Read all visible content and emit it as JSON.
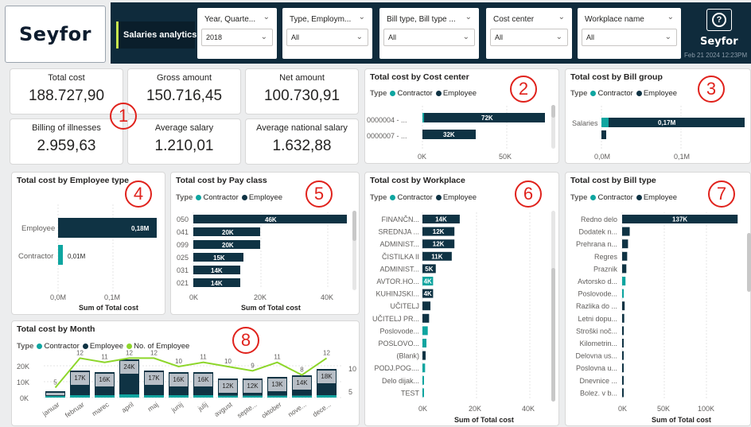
{
  "app": {
    "logo": "Seyfor",
    "report_title": "Salaries analytics",
    "header_logo": "Seyfor",
    "header_date": "Feb 21 2024 12:23PM"
  },
  "filters": [
    {
      "label": "Year, Quarte...",
      "value": "2018"
    },
    {
      "label": "Type, Employm...",
      "value": "All"
    },
    {
      "label": "Bill type, Bill type ...",
      "value": "All"
    },
    {
      "label": "Cost center",
      "value": "All"
    },
    {
      "label": "Workplace name",
      "value": "All"
    }
  ],
  "kpis": [
    {
      "label": "Total cost",
      "value": "188.727,90"
    },
    {
      "label": "Gross amount",
      "value": "150.716,45"
    },
    {
      "label": "Net amount",
      "value": "100.730,91"
    },
    {
      "label": "Billing of illnesses",
      "value": "2.959,63"
    },
    {
      "label": "Average salary",
      "value": "1.210,01"
    },
    {
      "label": "Average national salary",
      "value": "1.632,88"
    }
  ],
  "colors": {
    "contractor": "#0ea5a0",
    "employee": "#0f3344",
    "employees_line": "#8dd62a",
    "header": "#0f2b3c",
    "marker": "#e0221c",
    "gray_bar": "#b7bec6"
  },
  "legend": {
    "type": "Type",
    "contractor": "Contractor",
    "employee": "Employee",
    "no_employee": "No. of Employee"
  },
  "markers": [
    "1",
    "2",
    "3",
    "4",
    "5",
    "6",
    "7",
    "8"
  ],
  "cost_center": {
    "title": "Total cost by Cost center",
    "rows": [
      {
        "label": "0000004 - ...",
        "value": "72K"
      },
      {
        "label": "0000007 - ...",
        "value": "32K"
      }
    ],
    "ticks": [
      "0K",
      "50K"
    ]
  },
  "bill_group": {
    "title": "Total cost by Bill group",
    "rows": [
      {
        "label": "Salaries",
        "value": "0,17M"
      }
    ],
    "ticks": [
      "0,0M",
      "0,1M"
    ]
  },
  "employee_type": {
    "title": "Total cost by Employee type",
    "rows": [
      {
        "label": "Employee",
        "value": "0,18M"
      },
      {
        "label": "Contractor",
        "value": "0,01M"
      }
    ],
    "ticks": [
      "0,0M",
      "0,1M"
    ],
    "xlabel": "Sum of Total cost"
  },
  "pay_class": {
    "title": "Total cost by Pay class",
    "rows": [
      {
        "label": "050",
        "value": "46K"
      },
      {
        "label": "041",
        "value": "20K"
      },
      {
        "label": "099",
        "value": "20K"
      },
      {
        "label": "025",
        "value": "15K"
      },
      {
        "label": "031",
        "value": "14K"
      },
      {
        "label": "021",
        "value": "14K"
      }
    ],
    "ticks": [
      "0K",
      "20K",
      "40K"
    ],
    "xlabel": "Sum of Total cost"
  },
  "workplace": {
    "title": "Total cost by Workplace",
    "rows": [
      {
        "label": "FINANČN...",
        "value": "14K"
      },
      {
        "label": "SREDNJA ...",
        "value": "12K"
      },
      {
        "label": "ADMINIST...",
        "value": "12K"
      },
      {
        "label": "ČISTILKA II",
        "value": "11K"
      },
      {
        "label": "ADMINIST...",
        "value": "5K"
      },
      {
        "label": "AVTOR.HO...",
        "value": "4K"
      },
      {
        "label": "KUHINJSKI...",
        "value": "4K"
      },
      {
        "label": "UČITELJ",
        "value": ""
      },
      {
        "label": "UČITELJ PR...",
        "value": ""
      },
      {
        "label": "Poslovode...",
        "value": ""
      },
      {
        "label": "POSLOVO...",
        "value": ""
      },
      {
        "label": "(Blank)",
        "value": ""
      },
      {
        "label": "PODJ.POG....",
        "value": ""
      },
      {
        "label": "Delo dijak...",
        "value": ""
      },
      {
        "label": "TEST",
        "value": ""
      }
    ],
    "ticks": [
      "0K",
      "20K",
      "40K"
    ],
    "xlabel": "Sum of Total cost"
  },
  "bill_type": {
    "title": "Total cost by Bill type",
    "rows": [
      {
        "label": "Redno delo",
        "value": "137K"
      },
      {
        "label": "Dodatek n...",
        "value": ""
      },
      {
        "label": "Prehrana n...",
        "value": ""
      },
      {
        "label": "Regres",
        "value": ""
      },
      {
        "label": "Praznik",
        "value": ""
      },
      {
        "label": "Avtorsko d...",
        "value": ""
      },
      {
        "label": "Poslovode...",
        "value": ""
      },
      {
        "label": "Razlika do ...",
        "value": ""
      },
      {
        "label": "Letni dopu...",
        "value": ""
      },
      {
        "label": "Stroški noč...",
        "value": ""
      },
      {
        "label": "Kilometrin...",
        "value": ""
      },
      {
        "label": "Delovna us...",
        "value": ""
      },
      {
        "label": "Poslovna u...",
        "value": ""
      },
      {
        "label": "Dnevnice ...",
        "value": ""
      },
      {
        "label": "Bolez. v b...",
        "value": ""
      }
    ],
    "ticks": [
      "0K",
      "50K",
      "100K"
    ],
    "xlabel": "Sum of Total cost"
  },
  "chart_data": [
    {
      "type": "bar",
      "title": "Total cost by Cost center",
      "categories": [
        "0000004 - ...",
        "0000007 - ..."
      ],
      "series": [
        {
          "name": "Contractor",
          "values": [
            1000,
            0
          ]
        },
        {
          "name": "Employee",
          "values": [
            72000,
            32000
          ]
        }
      ],
      "xlim": [
        0,
        78000
      ]
    },
    {
      "type": "bar",
      "title": "Total cost by Bill group",
      "categories": [
        "Salaries",
        ""
      ],
      "series": [
        {
          "name": "Contractor",
          "values": [
            8000,
            0
          ]
        },
        {
          "name": "Employee",
          "values": [
            170000,
            6000
          ]
        }
      ],
      "xlim": [
        0,
        190000
      ]
    },
    {
      "type": "bar",
      "title": "Total cost by Employee type",
      "categories": [
        "Employee",
        "Contractor"
      ],
      "series": [
        {
          "values": [
            180000,
            10000
          ]
        }
      ],
      "xlim": [
        0,
        190000
      ],
      "xlabel": "Sum of Total cost"
    },
    {
      "type": "bar",
      "title": "Total cost by Pay class",
      "categories": [
        "050",
        "041",
        "099",
        "025",
        "031",
        "021"
      ],
      "series": [
        {
          "values": [
            46000,
            20000,
            20000,
            15000,
            14000,
            14000
          ]
        }
      ],
      "xlim": [
        0,
        50000
      ],
      "xlabel": "Sum of Total cost"
    },
    {
      "type": "bar",
      "title": "Total cost by Workplace",
      "categories": [
        "FINANČN...",
        "SREDNJA ...",
        "ADMINIST...",
        "ČISTILKA II",
        "ADMINIST...",
        "AVTOR.HO...",
        "KUHINJSKI...",
        "UČITELJ",
        "UČITELJ PR...",
        "Poslovode...",
        "POSLOVO...",
        "(Blank)",
        "PODJ.POG....",
        "Delo dijak...",
        "TEST"
      ],
      "series": [
        {
          "name": "Contractor",
          "values": [
            0,
            0,
            0,
            0,
            0,
            4000,
            0,
            0,
            0,
            2000,
            1500,
            0,
            1000,
            500,
            100
          ]
        },
        {
          "name": "Employee",
          "values": [
            14000,
            12000,
            12000,
            11000,
            5000,
            0,
            4000,
            3000,
            2500,
            0,
            0,
            1200,
            0,
            0,
            0
          ]
        }
      ],
      "xlim": [
        0,
        50000
      ],
      "xlabel": "Sum of Total cost"
    },
    {
      "type": "bar",
      "title": "Total cost by Bill type",
      "categories": [
        "Redno delo",
        "Dodatek n...",
        "Prehrana n...",
        "Regres",
        "Praznik",
        "Avtorsko d...",
        "Poslovode...",
        "Razlika do ...",
        "Letni dopu...",
        "Stroški noč...",
        "Kilometrin...",
        "Delovna us...",
        "Poslovna u...",
        "Dnevnice ...",
        "Bolez. v b..."
      ],
      "series": [
        {
          "name": "Contractor",
          "values": [
            0,
            0,
            0,
            0,
            0,
            4000,
            2000,
            0,
            0,
            0,
            0,
            0,
            0,
            0,
            0
          ]
        },
        {
          "name": "Employee",
          "values": [
            137000,
            9000,
            7000,
            6000,
            5000,
            0,
            0,
            3000,
            2500,
            2000,
            1800,
            1500,
            1200,
            1000,
            800
          ]
        }
      ],
      "xlim": [
        0,
        150000
      ],
      "xlabel": "Sum of Total cost"
    },
    {
      "type": "bar",
      "title": "Total cost by Month",
      "categories": [
        "januar",
        "februar",
        "marec",
        "april",
        "maj",
        "junij",
        "julij",
        "avgust",
        "septe...",
        "oktober",
        "nove...",
        "dece..."
      ],
      "series": [
        {
          "name": "Total (label)",
          "values": [
            "",
            "17K",
            "16K",
            "24K",
            "17K",
            "16K",
            "16K",
            "12K",
            "12K",
            "13K",
            "14K",
            "18K"
          ]
        },
        {
          "name": "Contractor",
          "values": [
            1000,
            1500,
            1500,
            2000,
            1500,
            1500,
            1500,
            1200,
            1200,
            1200,
            1200,
            1500
          ]
        },
        {
          "name": "Employee",
          "values": [
            3000,
            15500,
            14500,
            22000,
            15500,
            14500,
            14500,
            10800,
            10800,
            11800,
            12800,
            16500
          ]
        },
        {
          "name": "No. of Employee",
          "values": [
            5,
            12,
            11,
            12,
            12,
            10,
            11,
            10,
            9,
            11,
            8,
            12
          ]
        }
      ],
      "ylim": [
        0,
        25000
      ],
      "y2lim": [
        0,
        13
      ]
    }
  ],
  "month": {
    "title": "Total cost by Month",
    "yticks": [
      "20K",
      "10K",
      "0K"
    ],
    "y2ticks": [
      "10",
      "5"
    ],
    "months": [
      "januar",
      "februar",
      "marec",
      "april",
      "maj",
      "junij",
      "julij",
      "avgust",
      "septe...",
      "oktober",
      "nove...",
      "dece..."
    ],
    "bar_labels": [
      "",
      "17K",
      "16K",
      "24K",
      "17K",
      "16K",
      "16K",
      "12K",
      "12K",
      "13K",
      "14K",
      "18K"
    ],
    "emp_labels": [
      "5",
      "12",
      "11",
      "12",
      "12",
      "10",
      "11",
      "10",
      "9",
      "11",
      "8",
      "12"
    ]
  }
}
